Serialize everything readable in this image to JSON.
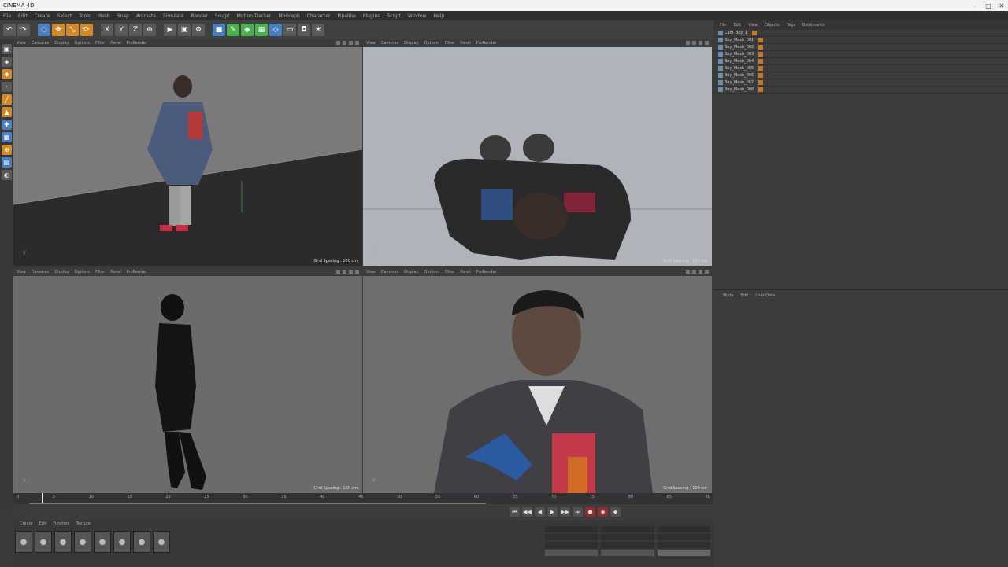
{
  "app": {
    "title": "CINEMA 4D",
    "window_controls": [
      "minimize-icon",
      "maximize-icon",
      "close-icon"
    ]
  },
  "menu": [
    "File",
    "Edit",
    "Create",
    "Select",
    "Tools",
    "Mesh",
    "Snap",
    "Animate",
    "Simulate",
    "Render",
    "Sculpt",
    "Motion Tracker",
    "MoGraph",
    "Character",
    "Pipeline",
    "Plugins",
    "Script",
    "Window",
    "Help"
  ],
  "toolbar": {
    "icons": [
      "undo-icon",
      "redo-icon",
      "live-select-icon",
      "move-icon",
      "scale-icon",
      "rotate-icon",
      "x-axis-icon",
      "y-axis-icon",
      "z-axis-icon",
      "world-icon",
      "render-view-icon",
      "render-picture-icon",
      "render-settings-icon",
      "cube-icon",
      "pen-icon",
      "subdivide-icon",
      "array-icon",
      "deformer-icon",
      "floor-icon",
      "camera-icon",
      "light-icon"
    ],
    "colors": {
      "orange": "#d08a2a",
      "blue": "#4a7fbf",
      "green": "#4caf50",
      "grey": "#5a5a5a"
    }
  },
  "viewports": [
    {
      "menu": [
        "View",
        "Cameras",
        "Display",
        "Options",
        "Filter",
        "Panel",
        "ProRender"
      ],
      "footer": "Grid Spacing : 100 cm",
      "axis": "Y"
    },
    {
      "menu": [
        "View",
        "Cameras",
        "Display",
        "Options",
        "Filter",
        "Panel",
        "ProRender"
      ],
      "footer": "Grid Spacing : 100 cm",
      "axis": "Y"
    },
    {
      "menu": [
        "View",
        "Cameras",
        "Display",
        "Options",
        "Filter",
        "Panel",
        "ProRender"
      ],
      "footer": "Grid Spacing : 100 cm",
      "axis": "Y"
    },
    {
      "menu": [
        "View",
        "Cameras",
        "Display",
        "Options",
        "Filter",
        "Panel",
        "ProRender"
      ],
      "footer": "Grid Spacing : 100 cm",
      "axis": "Y"
    }
  ],
  "timeline": {
    "ticks": [
      "0",
      "5",
      "10",
      "15",
      "20",
      "25",
      "30",
      "35",
      "40",
      "45",
      "50",
      "55",
      "60",
      "65",
      "70",
      "75",
      "80",
      "85",
      "90"
    ],
    "playhead_frame": 2
  },
  "transport": [
    "go-start-icon",
    "prev-key-icon",
    "play-back-icon",
    "play-icon",
    "next-key-icon",
    "go-end-icon",
    "record-icon",
    "auto-key-icon",
    "keyframe-icon"
  ],
  "materials": {
    "menu": [
      "Create",
      "Edit",
      "Function",
      "Texture"
    ],
    "count": 8
  },
  "objects": {
    "tabs": [
      "File",
      "Edit",
      "View",
      "Objects",
      "Tags",
      "Bookmarks"
    ],
    "items": [
      "Cam_Boy_1",
      "Boy_Mesh_001",
      "Boy_Mesh_002",
      "Boy_Mesh_003",
      "Boy_Mesh_004",
      "Boy_Mesh_005",
      "Boy_Mesh_006",
      "Boy_Mesh_007",
      "Boy_Mesh_008"
    ]
  },
  "attributes": {
    "tabs": [
      "Mode",
      "Edit",
      "User Data"
    ]
  }
}
